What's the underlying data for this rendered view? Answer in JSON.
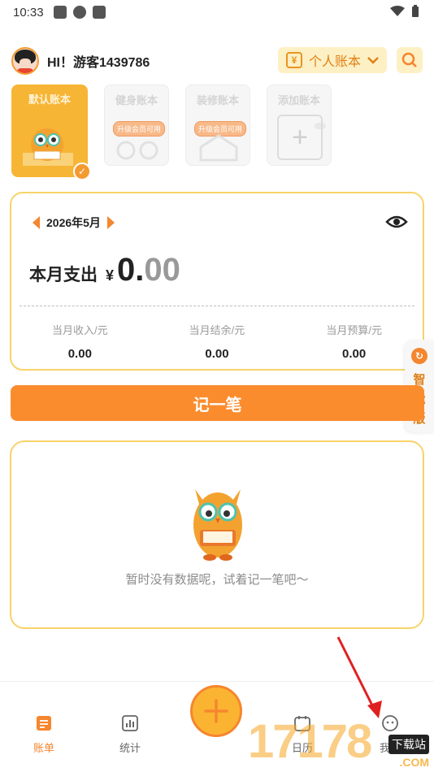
{
  "status_bar": {
    "time": "10:33"
  },
  "header": {
    "greeting": "HI！游客1439786",
    "account_switch_label": "个人账本",
    "account_coin": "¥"
  },
  "books": [
    {
      "title": "默认账本",
      "badge": ""
    },
    {
      "title": "健身账本",
      "badge": "升级会员可用"
    },
    {
      "title": "装修账本",
      "badge": "升级会员可用"
    },
    {
      "title": "添加账本",
      "badge": ""
    }
  ],
  "summary": {
    "month": "2026年5月",
    "expense_label": "本月支出",
    "currency": "¥",
    "amount_integer": "0.",
    "amount_decimal": "00",
    "stats": [
      {
        "label": "当月收入/元",
        "value": "0.00"
      },
      {
        "label": "当月结余/元",
        "value": "0.00"
      },
      {
        "label": "当月预算/元",
        "value": "0.00"
      }
    ]
  },
  "smart_tab": {
    "label": "智能版"
  },
  "record_button": {
    "label": "记一笔"
  },
  "empty_state": {
    "message": "暂时没有数据呢，试着记一笔吧～"
  },
  "tabbar": {
    "items": [
      {
        "label": "账单"
      },
      {
        "label": "统计"
      },
      {
        "label": "日历"
      },
      {
        "label": "我的"
      }
    ]
  },
  "watermark": {
    "digits": "17178",
    "site": "下载站",
    "domain": ".COM"
  },
  "colors": {
    "accent": "#fb8c2e",
    "border": "#f8d36a",
    "light": "#fdf0c4"
  }
}
